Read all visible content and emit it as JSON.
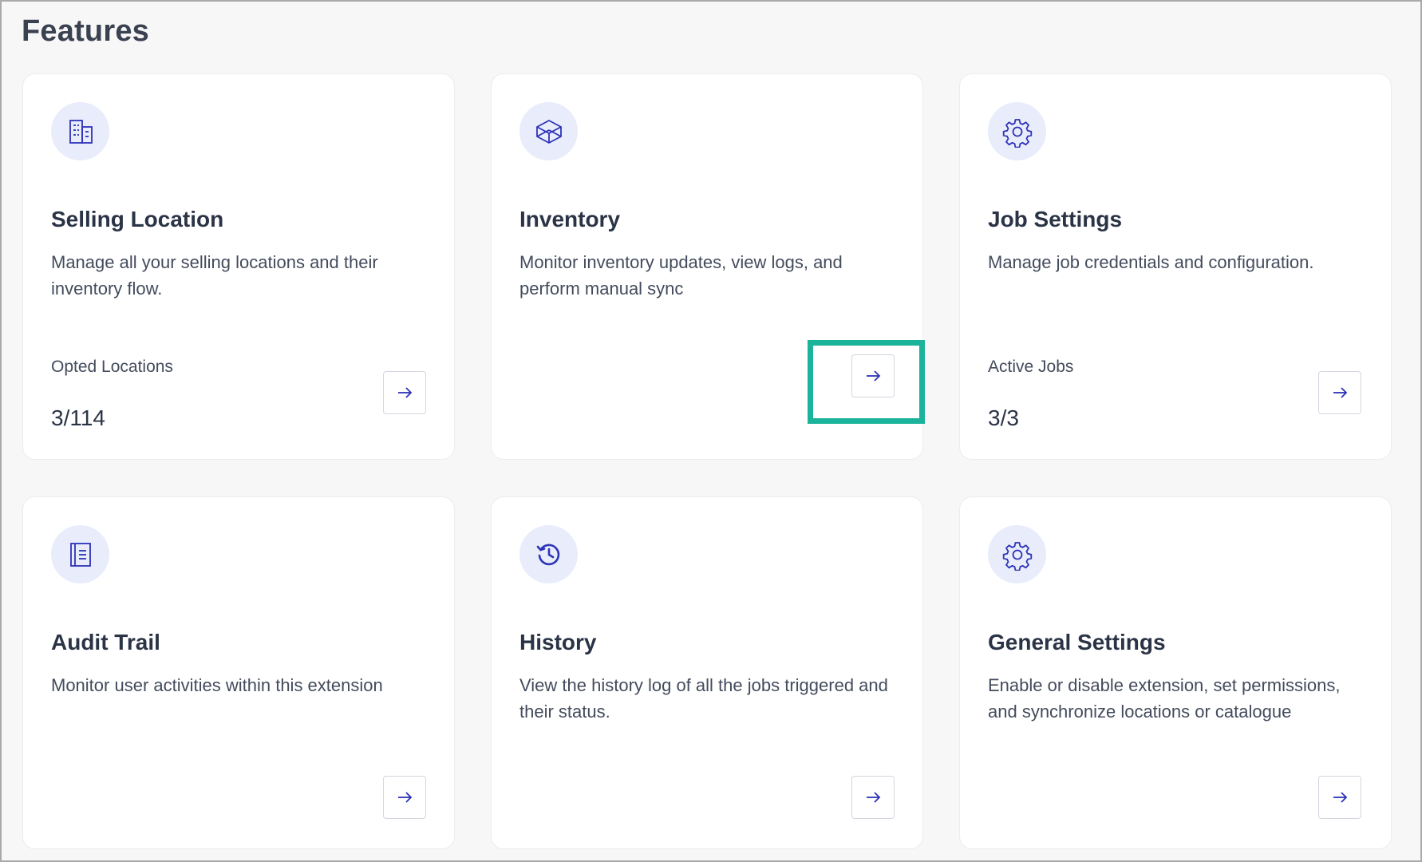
{
  "page": {
    "title": "Features"
  },
  "colors": {
    "accent": "#2d33b8",
    "icon_bg": "#e8ecfb",
    "highlight": "#1bb39a"
  },
  "cards": [
    {
      "title": "Selling Location",
      "description": "Manage all your selling locations and their inventory flow.",
      "icon": "building-icon",
      "stat_label": "Opted Locations",
      "stat_value": "3/114"
    },
    {
      "title": "Inventory",
      "description": "Monitor inventory updates, view logs, and perform manual sync",
      "icon": "cube-icon"
    },
    {
      "title": "Job Settings",
      "description": "Manage job credentials and configuration.",
      "icon": "gear-icon",
      "stat_label": "Active Jobs",
      "stat_value": "3/3"
    },
    {
      "title": "Audit Trail",
      "description": "Monitor user activities within this extension",
      "icon": "notebook-icon"
    },
    {
      "title": "History",
      "description": "View the history log of all the jobs triggered and their status.",
      "icon": "history-icon"
    },
    {
      "title": "General Settings",
      "description": "Enable or disable extension, set permissions, and synchronize locations or catalogue",
      "icon": "gear-icon"
    }
  ]
}
